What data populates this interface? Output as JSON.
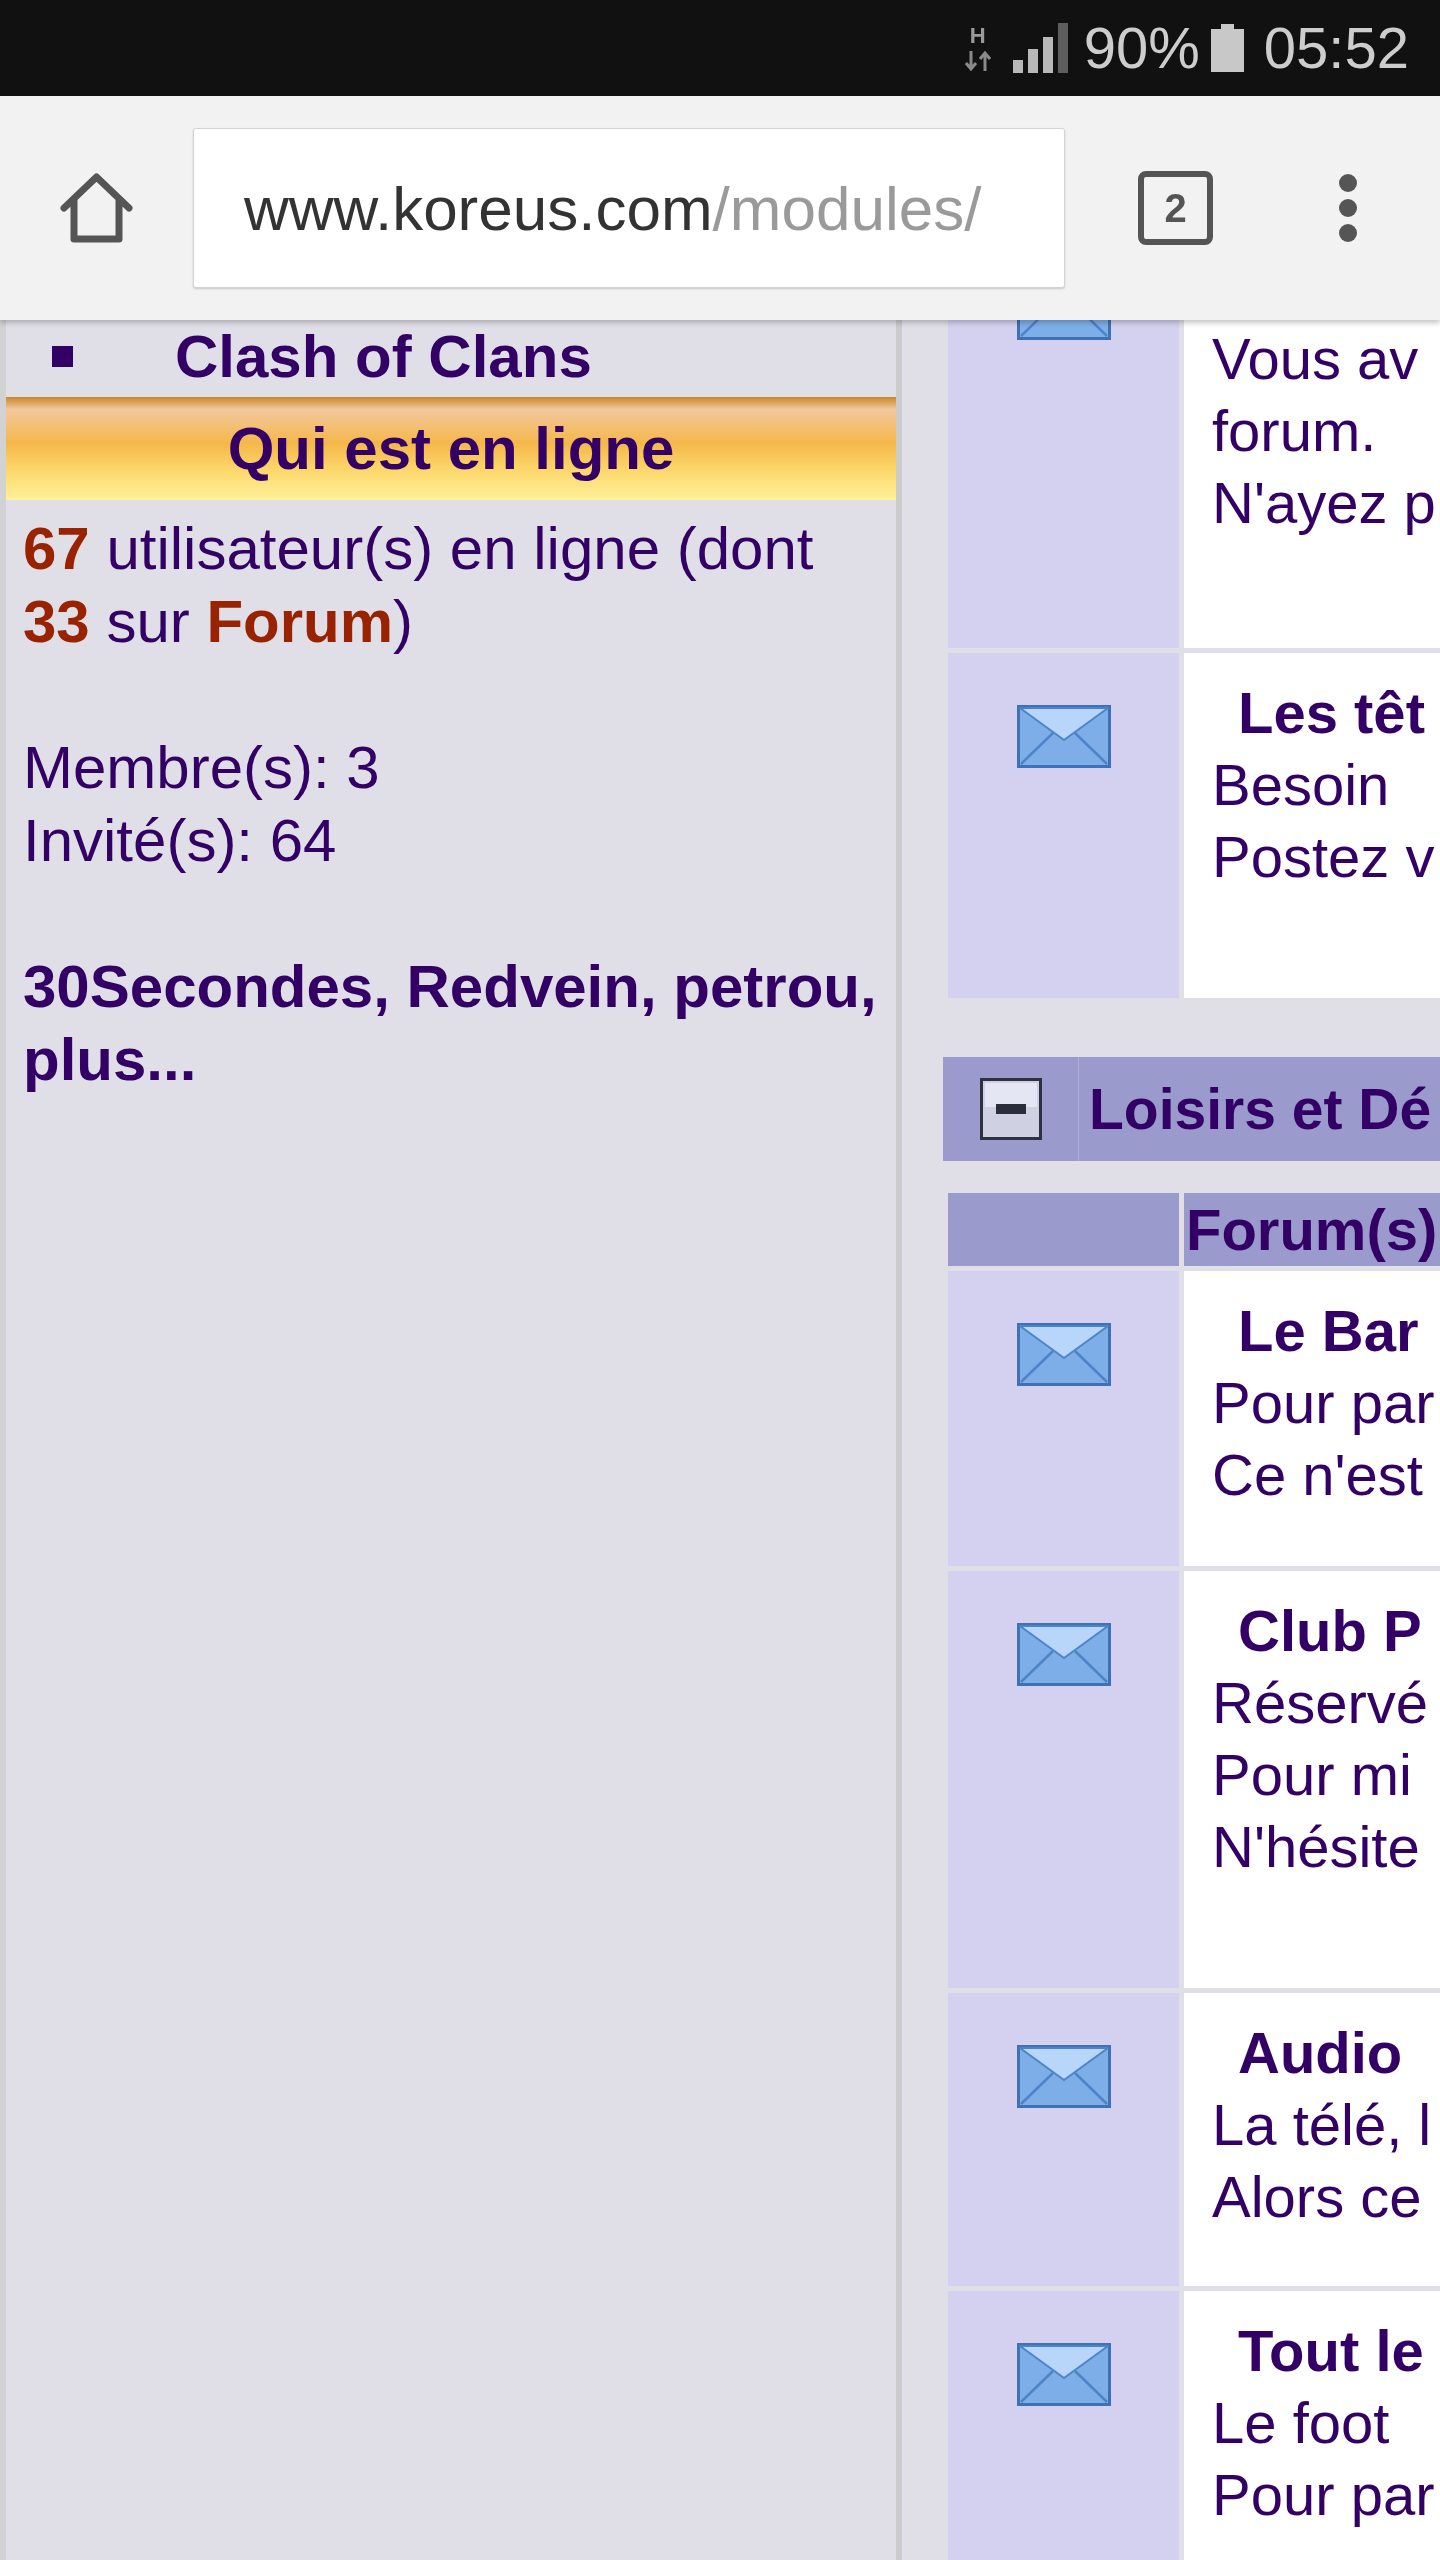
{
  "status_bar": {
    "network_type": "H",
    "battery": "90%",
    "time": "05:52"
  },
  "browser": {
    "url_host": "www.koreus.com",
    "url_path": "/modules/",
    "tab_count": "2"
  },
  "left_panel": {
    "menu_items": [
      "Clash of Clans"
    ],
    "online_block": {
      "title": "Qui est en ligne",
      "summary": "**67** utilisateur(s) en ligne (dont **33** sur **Forum**)",
      "members": "Membre(s): 3",
      "guests": "Invité(s): 64",
      "users": [
        "30Secondes",
        "Redvein",
        "petrou"
      ],
      "separator": ",",
      "more": "plus..."
    }
  },
  "forum_sections": [
    {
      "rows": [
        {
          "lines": [
            "Vous av",
            "forum.",
            "N'ayez p"
          ]
        },
        {
          "title": "Les têt",
          "lines": [
            "Besoin",
            "Postez v"
          ]
        }
      ]
    },
    {
      "title": "Loisirs et Dé",
      "expanded": true,
      "column_header": "Forum(s)",
      "rows": [
        {
          "title": "Le Bar",
          "lines": [
            "Pour par",
            "Ce n'est"
          ]
        },
        {
          "title": "Club P",
          "lines": [
            "Réservé",
            "Pour mi",
            "N'hésite"
          ]
        },
        {
          "title": "Audio",
          "lines": [
            "La télé, l",
            "Alors ce"
          ]
        },
        {
          "title": "Tout le",
          "lines": [
            "Le foot",
            "Pour par"
          ]
        }
      ]
    }
  ]
}
